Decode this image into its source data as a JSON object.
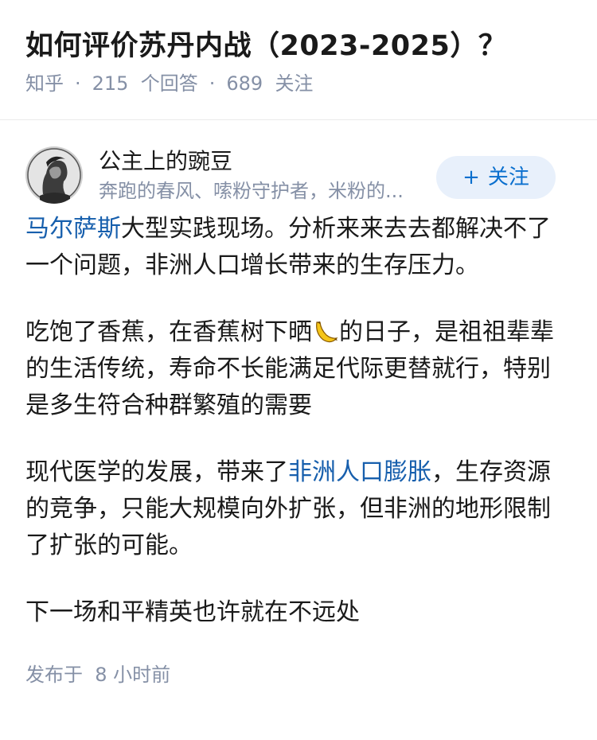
{
  "question": {
    "title": "如何评价苏丹内战（2023-2025）？",
    "source": "知乎",
    "sep": "·",
    "answer_count": "215",
    "answer_label": "个回答",
    "follow_count": "689",
    "follow_label": "关注"
  },
  "author": {
    "name": "公主上的豌豆",
    "bio": "奔跑的春风、嗦粉守护者，米粉的...",
    "follow_plus": "+",
    "follow_label": "关注"
  },
  "answer": {
    "p1_link": "马尔萨斯",
    "p1_rest": "大型实践现场。分析来来去去都解决不了一个问题，非洲人口增长带来的生存压力。",
    "p2_before": "吃饱了香蕉，在香蕉树下晒",
    "p2_icon": "banana-emoji-icon",
    "p2_after": "的日子，是祖祖辈辈的生活传统，寿命不长能满足代际更替就行，特别是多生符合种群繁殖的需要",
    "p3_before": "现代医学的发展，带来了",
    "p3_link": "非洲人口膨胀",
    "p3_after": "，生存资源的竞争，只能大规模向外扩张，但非洲的地形限制了扩张的可能。",
    "p4": "下一场和平精英也许就在不远处"
  },
  "footer": {
    "published_label": "发布于",
    "published_time": "8 小时前"
  },
  "colors": {
    "link": "#175fad",
    "meta": "#8590a6",
    "follow_bg": "#e8f0fb",
    "follow_text": "#0a6fce"
  }
}
